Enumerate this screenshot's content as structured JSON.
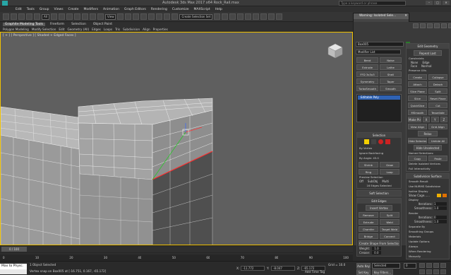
{
  "window": {
    "title": "Autodesk 3ds Max 2017 x64   Rock_Rail.max",
    "search_placeholder": "Type a keyword or phrase"
  },
  "menu": [
    "Edit",
    "Tools",
    "Group",
    "Views",
    "Create",
    "Modifiers",
    "Animation",
    "Graph Editors",
    "Rendering",
    "Customize",
    "MAXScript",
    "Help"
  ],
  "toolbar": {
    "selection_filter": "All",
    "view_dropdown": "View",
    "named_selection": "Create Selection Set"
  },
  "ribbon": {
    "tabs": [
      "Graphite Modeling Tools",
      "Freeform",
      "Selection",
      "Object Paint"
    ],
    "subtabs": [
      "Polygon Modeling",
      "Modify Selection",
      "Edit",
      "Geometry (All)",
      "Edges",
      "Loops",
      "Tris",
      "Subdivision",
      "Align",
      "Properties"
    ]
  },
  "viewport": {
    "label": "[ + ] [ Perspective ] [ Shaded + Edged Faces ]"
  },
  "isolate_dialog": {
    "title": "Warning: Isolated Sele...",
    "button": "Exit Isolation Mode"
  },
  "command_panel": {
    "object_name": "Box005",
    "modifier_list": "Modifier List",
    "modifier_buttons": [
      "Bend",
      "Noise",
      "Extrude",
      "Lathe",
      "FFD 3x3x3",
      "Shell",
      "Symmetry",
      "Taper",
      "TurboSmooth",
      "Smooth"
    ],
    "stack_item": "Editable Poly",
    "selection": {
      "title": "Selection",
      "options": [
        "By Vertex",
        "Ignore Backfacing",
        "By Angle:  45.0"
      ],
      "buttons": [
        "Shrink",
        "Grow",
        "Ring",
        "Loop"
      ],
      "preview": "Preview Selection",
      "preview_opts": [
        "Off",
        "SubObj",
        "Multi"
      ],
      "status": "16 Edges Selected"
    },
    "soft_selection": "Soft Selection",
    "edit_edges": {
      "title": "Edit Edges",
      "insert": "Insert Vertex",
      "buttons": [
        "Remove",
        "Split",
        "Extrude",
        "Weld",
        "Chamfer",
        "Target Weld",
        "Bridge",
        "Connect"
      ],
      "create_shape": "Create Shape From Selection",
      "weight_label": "Weight:",
      "weight": "1.0",
      "crease_label": "Crease:",
      "crease": "0.0"
    },
    "edit_geometry": {
      "title": "Edit Geometry",
      "repeat_last": "Repeat Last",
      "constraints": "Constraints",
      "constraint_opts": [
        "None",
        "Edge",
        "Face",
        "Normal"
      ],
      "preserve_uvs": "Preserve UVs",
      "buttons": [
        "Create",
        "Collapse",
        "Attach",
        "Detach"
      ],
      "slice_plane": "Slice Plane",
      "split": "Split",
      "slice": "Slice",
      "reset_plane": "Reset Plane",
      "quickslice": "QuickSlice",
      "cut": "Cut",
      "msmooth": "MSmooth",
      "tessellate": "Tessellate",
      "make_planar": "Make Planar",
      "xyz": [
        "X",
        "Y",
        "Z"
      ],
      "view_align": "View Align",
      "grid_align": "Grid Align",
      "relax": "Relax",
      "hide_selected": "Hide Selected",
      "unhide_all": "Unhide All",
      "hide_unselected": "Hide Unselected",
      "named_selections": "Named Selections:",
      "copy": "Copy",
      "paste": "Paste",
      "delete_isolated": "Delete Isolated Vertices",
      "full_interactivity": "Full Interactivity"
    },
    "subdivision_surface": {
      "title": "Subdivision Surface",
      "options": [
        "Smooth Result",
        "Use NURMS Subdivision",
        "Isoline Display",
        "Show Cage......"
      ],
      "display": "Display",
      "iterations_label": "Iterations:",
      "iterations": "1",
      "smoothness_label": "Smoothness:",
      "smoothness": "1.0",
      "render": "Render",
      "render_iterations": "0",
      "render_smoothness": "1.0",
      "separate_by": "Separate By",
      "separate_opts": [
        "Smoothing Groups",
        "Materials"
      ],
      "update_options": "Update Options",
      "update_opts": [
        "Always",
        "When Rendering",
        "Manually"
      ],
      "update_btn": "Update"
    }
  },
  "timeline": {
    "frame": "0 / 100",
    "ticks": [
      "0",
      "5",
      "10",
      "15",
      "20",
      "25",
      "30",
      "35",
      "40",
      "45",
      "50",
      "55",
      "60",
      "65",
      "70",
      "75",
      "80",
      "85",
      "90",
      "95",
      "100"
    ]
  },
  "status": {
    "maxscript": "Max to Physc.",
    "maxscript2": "",
    "selected": "1 Object Selected",
    "prompt": "Vertex snap on Box005 at [-16.751, 0.167, -65.172]",
    "x_label": "X:",
    "x": "-11.772",
    "y_label": "Y:",
    "y": "-8.047",
    "z_label": "Z:",
    "z": "-65.172",
    "grid": "Grid = 10.0",
    "add_time_tag": "Add Time Tag",
    "auto_key": "Auto Key",
    "selected_btn": "Selected",
    "set_key": "Set Key",
    "key_filters": "Key Filters...",
    "frame_num": "0"
  },
  "colors": {
    "accent": "#2978c2",
    "selection_highlight": "#2f62b3",
    "viewport_bg": "#5f5f5f",
    "active_border": "#f0c000",
    "selected_edges": "#ff2a2a"
  }
}
